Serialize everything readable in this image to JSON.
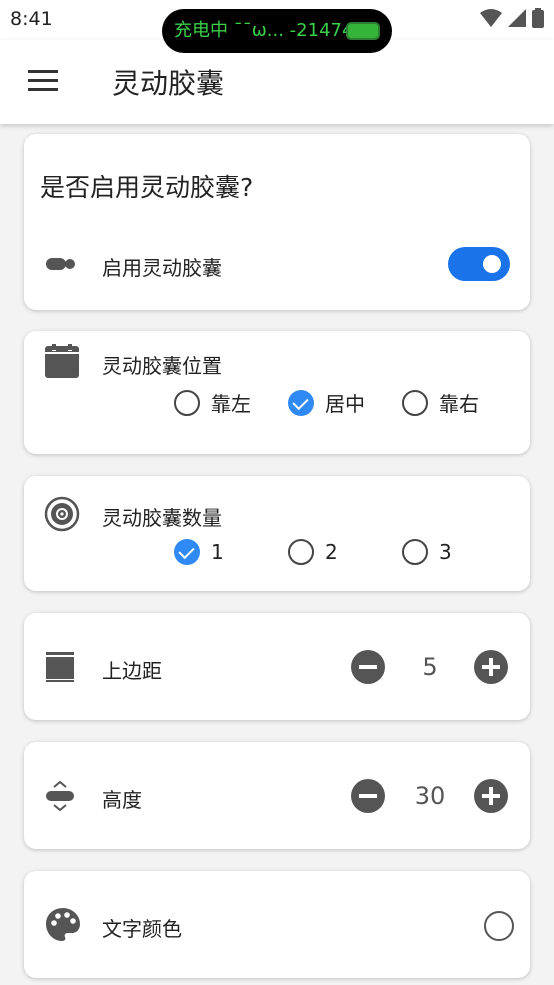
{
  "status_bar": {
    "time": "8:41",
    "island_text": "充电中 ¯¯ω... -21474",
    "icons": [
      "wifi-icon",
      "signal-icon",
      "battery-icon"
    ]
  },
  "app_bar": {
    "title": "灵动胶囊",
    "menu_icon": "menu-icon"
  },
  "enable_card": {
    "heading": "是否启用灵动胶囊?",
    "icon": "capsule-icon",
    "label": "启用灵动胶囊",
    "enabled": true
  },
  "position_card": {
    "icon": "calendar-icon",
    "label": "灵动胶囊位置",
    "options": [
      {
        "label": "靠左",
        "selected": false
      },
      {
        "label": "居中",
        "selected": true
      },
      {
        "label": "靠右",
        "selected": false
      }
    ]
  },
  "count_card": {
    "icon": "target-icon",
    "label": "灵动胶囊数量",
    "options": [
      {
        "label": "1",
        "selected": true
      },
      {
        "label": "2",
        "selected": false
      },
      {
        "label": "3",
        "selected": false
      }
    ]
  },
  "top_margin_card": {
    "icon": "top-margin-icon",
    "label": "上边距",
    "value": "5"
  },
  "height_card": {
    "icon": "height-icon",
    "label": "高度",
    "value": "30"
  },
  "text_color_card": {
    "icon": "palette-icon",
    "label": "文字颜色",
    "color": "#ffffff"
  },
  "colors": {
    "accent": "#1a73e8",
    "radio_checked": "#2f8af5",
    "island_text": "#3ad04a"
  }
}
